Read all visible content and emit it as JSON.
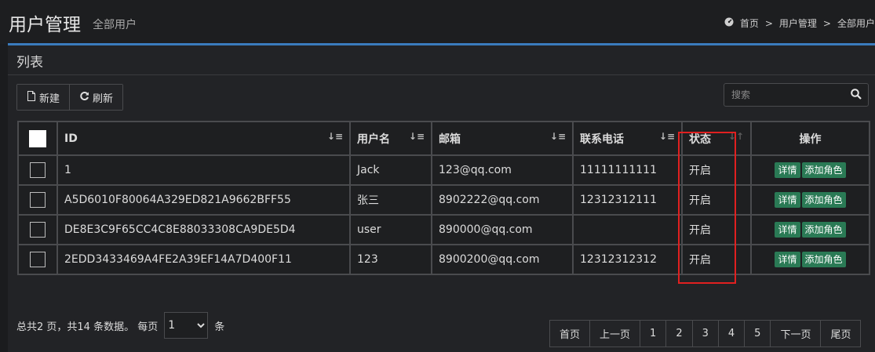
{
  "header": {
    "title": "用户管理",
    "subtitle": "全部用户",
    "breadcrumb": {
      "home": "首页",
      "sep": ">",
      "mid": "用户管理",
      "current": "全部用户"
    }
  },
  "panel": {
    "title": "列表"
  },
  "toolbar": {
    "new_label": "新建",
    "refresh_label": "刷新"
  },
  "search": {
    "placeholder": "搜索"
  },
  "table": {
    "headers": {
      "id": "ID",
      "username": "用户名",
      "email": "邮箱",
      "phone": "联系电话",
      "status": "状态",
      "actions": "操作"
    },
    "rows": [
      {
        "id": "1",
        "username": "Jack",
        "email": "123@qq.com",
        "phone": "11111111111",
        "status": "开启",
        "detail": "详情",
        "add_role": "添加角色"
      },
      {
        "id": "A5D6010F80064A329ED821A9662BFF55",
        "username": "张三",
        "email": "8902222@qq.com",
        "phone": "12312312111",
        "status": "开启",
        "detail": "详情",
        "add_role": "添加角色"
      },
      {
        "id": "DE8E3C9F65CC4C8E88033308CA9DE5D4",
        "username": "user",
        "email": "890000@qq.com",
        "phone": "",
        "status": "开启",
        "detail": "详情",
        "add_role": "添加角色"
      },
      {
        "id": "2EDD3433469A4FE2A39EF14A7D400F11",
        "username": "123",
        "email": "8900200@qq.com",
        "phone": "12312312312",
        "status": "开启",
        "detail": "详情",
        "add_role": "添加角色"
      }
    ]
  },
  "pager": {
    "summary": "总共2 页，共14 条数据。 每页",
    "page_size": "1",
    "unit": "条",
    "pages": [
      "首页",
      "上一页",
      "1",
      "2",
      "3",
      "4",
      "5",
      "下一页",
      "尾页"
    ]
  },
  "colors": {
    "accent": "#3a7bbd",
    "action_green": "#2a7a55",
    "highlight_red": "#e02020"
  }
}
